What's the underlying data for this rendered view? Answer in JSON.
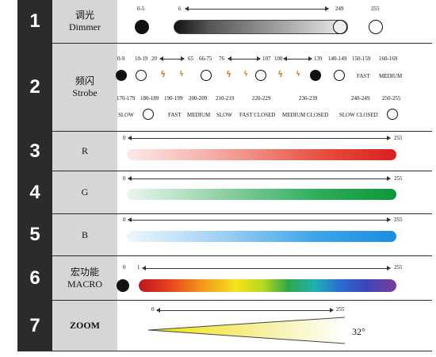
{
  "rows": [
    {
      "num": "1",
      "zh": "调光",
      "en": "Dimmer"
    },
    {
      "num": "2",
      "zh": "频闪",
      "en": "Strobe"
    },
    {
      "num": "3",
      "zh": "",
      "en": "R"
    },
    {
      "num": "4",
      "zh": "",
      "en": "G"
    },
    {
      "num": "5",
      "zh": "",
      "en": "B"
    },
    {
      "num": "6",
      "zh": "宏功能",
      "en": "MACRO"
    },
    {
      "num": "7",
      "zh": "",
      "en": "ZOOM"
    }
  ],
  "dimmer": {
    "range_a": "0-5",
    "start": "6",
    "end": "249",
    "range_b": "255"
  },
  "strobe": {
    "top_ranges": [
      "0-9",
      "10-19",
      "20",
      "65",
      "66-75",
      "76",
      "107",
      "108",
      "139",
      "140-149",
      "150-159",
      "160-169"
    ],
    "fast": "FAST",
    "medium": "MEDIUM",
    "bottom_ranges": [
      "170-179",
      "180-189",
      "190-199",
      "200-209",
      "210-219",
      "220-229",
      "230-239",
      "240-249",
      "250-255"
    ],
    "bottom_labels": [
      "SLOW",
      "FAST",
      "MEDIUM",
      "SLOW",
      "FAST CLOSED",
      "MEDIUM CLOSED",
      "SLOW CLOSED"
    ]
  },
  "r": {
    "min": "0",
    "max": "255",
    "color": "#e02020"
  },
  "g": {
    "min": "0",
    "max": "255",
    "color": "#109a3a"
  },
  "b": {
    "min": "0",
    "max": "255",
    "color": "#1d8fe0"
  },
  "macro": {
    "zero": "0",
    "one": "1",
    "max": "255"
  },
  "zoom": {
    "min": "0",
    "max": "255",
    "angle": "32°"
  }
}
